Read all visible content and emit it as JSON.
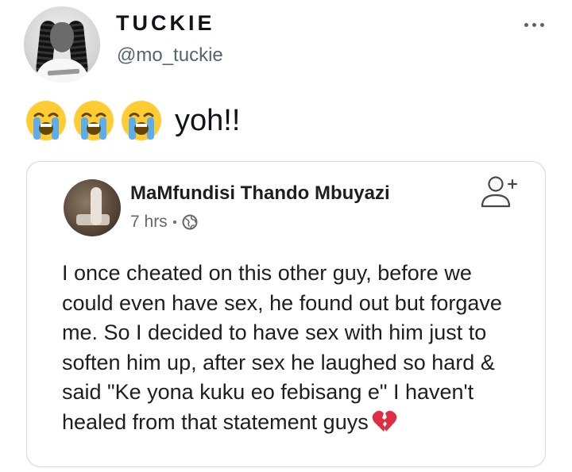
{
  "tweet": {
    "author": {
      "display_name": "TUCKIE",
      "handle": "@mo_tuckie",
      "avatar_icon": "user-avatar"
    },
    "more_icon": "more-horizontal-icon",
    "text": {
      "emojis": [
        "loudly-crying-face",
        "loudly-crying-face",
        "loudly-crying-face"
      ],
      "words": "yoh!!"
    }
  },
  "quoted_post": {
    "author_name": "MaMfundisi Thando Mbuyazi",
    "time": "7 hrs",
    "separator": "·",
    "privacy_icon": "globe-icon",
    "action_icon": "add-friend-icon",
    "body": "I once cheated on this other guy, before we could even have sex, he found out but forgave me. So I decided to have sex with him just to soften him up, after sex he laughed so hard & said \"Ke yona kuku eo febisang e\" I haven't healed from that statement guys",
    "trailing_emoji": "broken-heart"
  },
  "colors": {
    "text_primary": "#0f1419",
    "text_secondary": "#536471",
    "fb_text": "#1c1e21",
    "fb_meta": "#65676b",
    "card_border": "#cfd9de",
    "emoji_yellow": "#ffcc33",
    "tears_blue": "#5dadec",
    "heart_red": "#dd2e44"
  }
}
